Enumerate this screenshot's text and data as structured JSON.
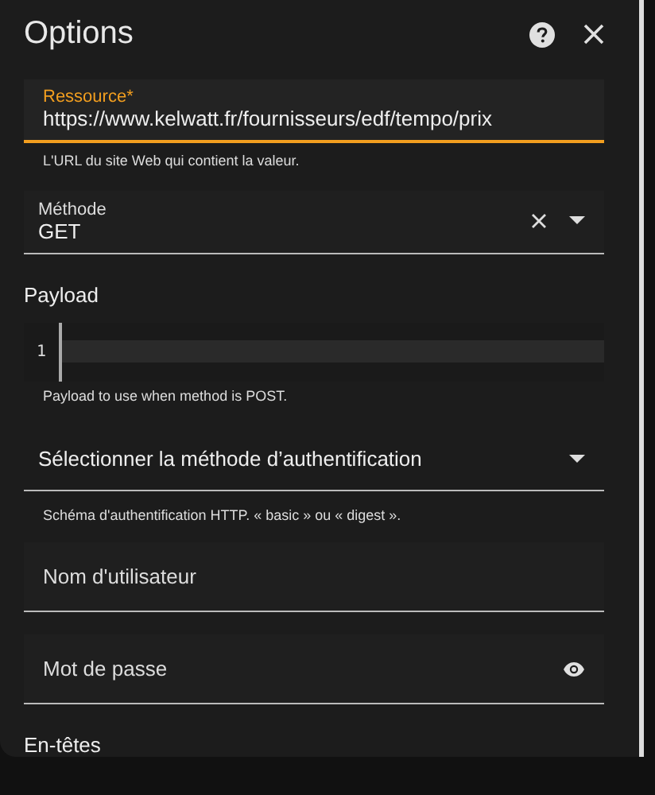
{
  "dialog": {
    "title": "Options"
  },
  "resource": {
    "label": "Ressource*",
    "value": "https://www.kelwatt.fr/fournisseurs/edf/tempo/prix",
    "helper": "L'URL du site Web qui contient la valeur.",
    "focused": true
  },
  "method": {
    "label": "Méthode",
    "value": "GET"
  },
  "payload": {
    "title": "Payload",
    "line_number": "1",
    "helper": "Payload to use when method is POST."
  },
  "auth": {
    "placeholder": "Sélectionner la méthode d’authentification",
    "helper": "Schéma d'authentification HTTP. « basic » ou « digest »."
  },
  "username": {
    "placeholder": "Nom d'utilisateur"
  },
  "password": {
    "placeholder": "Mot de passe"
  },
  "headers": {
    "title": "En-têtes"
  }
}
